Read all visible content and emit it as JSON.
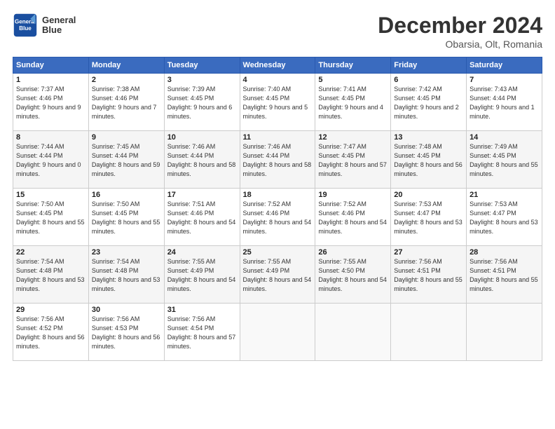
{
  "header": {
    "logo_line1": "General",
    "logo_line2": "Blue",
    "month": "December 2024",
    "location": "Obarsia, Olt, Romania"
  },
  "weekdays": [
    "Sunday",
    "Monday",
    "Tuesday",
    "Wednesday",
    "Thursday",
    "Friday",
    "Saturday"
  ],
  "weeks": [
    [
      {
        "day": "1",
        "sunrise": "7:37 AM",
        "sunset": "4:46 PM",
        "daylight": "9 hours and 9 minutes."
      },
      {
        "day": "2",
        "sunrise": "7:38 AM",
        "sunset": "4:46 PM",
        "daylight": "9 hours and 7 minutes."
      },
      {
        "day": "3",
        "sunrise": "7:39 AM",
        "sunset": "4:45 PM",
        "daylight": "9 hours and 6 minutes."
      },
      {
        "day": "4",
        "sunrise": "7:40 AM",
        "sunset": "4:45 PM",
        "daylight": "9 hours and 5 minutes."
      },
      {
        "day": "5",
        "sunrise": "7:41 AM",
        "sunset": "4:45 PM",
        "daylight": "9 hours and 4 minutes."
      },
      {
        "day": "6",
        "sunrise": "7:42 AM",
        "sunset": "4:45 PM",
        "daylight": "9 hours and 2 minutes."
      },
      {
        "day": "7",
        "sunrise": "7:43 AM",
        "sunset": "4:44 PM",
        "daylight": "9 hours and 1 minute."
      }
    ],
    [
      {
        "day": "8",
        "sunrise": "7:44 AM",
        "sunset": "4:44 PM",
        "daylight": "9 hours and 0 minutes."
      },
      {
        "day": "9",
        "sunrise": "7:45 AM",
        "sunset": "4:44 PM",
        "daylight": "8 hours and 59 minutes."
      },
      {
        "day": "10",
        "sunrise": "7:46 AM",
        "sunset": "4:44 PM",
        "daylight": "8 hours and 58 minutes."
      },
      {
        "day": "11",
        "sunrise": "7:46 AM",
        "sunset": "4:44 PM",
        "daylight": "8 hours and 58 minutes."
      },
      {
        "day": "12",
        "sunrise": "7:47 AM",
        "sunset": "4:45 PM",
        "daylight": "8 hours and 57 minutes."
      },
      {
        "day": "13",
        "sunrise": "7:48 AM",
        "sunset": "4:45 PM",
        "daylight": "8 hours and 56 minutes."
      },
      {
        "day": "14",
        "sunrise": "7:49 AM",
        "sunset": "4:45 PM",
        "daylight": "8 hours and 55 minutes."
      }
    ],
    [
      {
        "day": "15",
        "sunrise": "7:50 AM",
        "sunset": "4:45 PM",
        "daylight": "8 hours and 55 minutes."
      },
      {
        "day": "16",
        "sunrise": "7:50 AM",
        "sunset": "4:45 PM",
        "daylight": "8 hours and 55 minutes."
      },
      {
        "day": "17",
        "sunrise": "7:51 AM",
        "sunset": "4:46 PM",
        "daylight": "8 hours and 54 minutes."
      },
      {
        "day": "18",
        "sunrise": "7:52 AM",
        "sunset": "4:46 PM",
        "daylight": "8 hours and 54 minutes."
      },
      {
        "day": "19",
        "sunrise": "7:52 AM",
        "sunset": "4:46 PM",
        "daylight": "8 hours and 54 minutes."
      },
      {
        "day": "20",
        "sunrise": "7:53 AM",
        "sunset": "4:47 PM",
        "daylight": "8 hours and 53 minutes."
      },
      {
        "day": "21",
        "sunrise": "7:53 AM",
        "sunset": "4:47 PM",
        "daylight": "8 hours and 53 minutes."
      }
    ],
    [
      {
        "day": "22",
        "sunrise": "7:54 AM",
        "sunset": "4:48 PM",
        "daylight": "8 hours and 53 minutes."
      },
      {
        "day": "23",
        "sunrise": "7:54 AM",
        "sunset": "4:48 PM",
        "daylight": "8 hours and 53 minutes."
      },
      {
        "day": "24",
        "sunrise": "7:55 AM",
        "sunset": "4:49 PM",
        "daylight": "8 hours and 54 minutes."
      },
      {
        "day": "25",
        "sunrise": "7:55 AM",
        "sunset": "4:49 PM",
        "daylight": "8 hours and 54 minutes."
      },
      {
        "day": "26",
        "sunrise": "7:55 AM",
        "sunset": "4:50 PM",
        "daylight": "8 hours and 54 minutes."
      },
      {
        "day": "27",
        "sunrise": "7:56 AM",
        "sunset": "4:51 PM",
        "daylight": "8 hours and 55 minutes."
      },
      {
        "day": "28",
        "sunrise": "7:56 AM",
        "sunset": "4:51 PM",
        "daylight": "8 hours and 55 minutes."
      }
    ],
    [
      {
        "day": "29",
        "sunrise": "7:56 AM",
        "sunset": "4:52 PM",
        "daylight": "8 hours and 56 minutes."
      },
      {
        "day": "30",
        "sunrise": "7:56 AM",
        "sunset": "4:53 PM",
        "daylight": "8 hours and 56 minutes."
      },
      {
        "day": "31",
        "sunrise": "7:56 AM",
        "sunset": "4:54 PM",
        "daylight": "8 hours and 57 minutes."
      },
      null,
      null,
      null,
      null
    ]
  ]
}
